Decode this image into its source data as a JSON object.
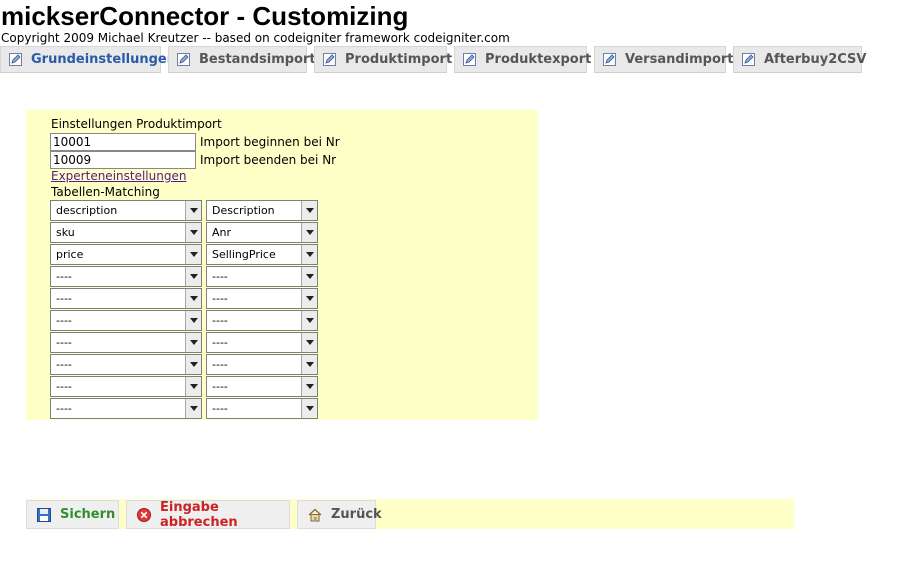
{
  "header": {
    "title": "mickserConnector - Customizing",
    "copyright": "Copyright 2009 Michael Kreutzer -- based on codeigniter framework codeigniter.com"
  },
  "tabs": [
    {
      "label": "Grundeinstellungen",
      "active": true
    },
    {
      "label": "Bestandsimport"
    },
    {
      "label": "Produktimport"
    },
    {
      "label": "Produktexport"
    },
    {
      "label": "Versandimport"
    },
    {
      "label": "Afterbuy2CSV"
    }
  ],
  "form": {
    "section_title": "Einstellungen Produktimport",
    "start_value": "10001",
    "start_label": "Import beginnen bei Nr",
    "end_value": "10009",
    "end_label": "Import beenden bei Nr",
    "expert_link": "Experteneinstellungen",
    "matching_title": "Tabellen-Matching",
    "matching": [
      {
        "left": "description",
        "right": "Description"
      },
      {
        "left": "sku",
        "right": "Anr"
      },
      {
        "left": "price",
        "right": "SellingPrice"
      },
      {
        "left": "----",
        "right": "----"
      },
      {
        "left": "----",
        "right": "----"
      },
      {
        "left": "----",
        "right": "----"
      },
      {
        "left": "----",
        "right": "----"
      },
      {
        "left": "----",
        "right": "----"
      },
      {
        "left": "----",
        "right": "----"
      },
      {
        "left": "----",
        "right": "----"
      }
    ]
  },
  "actions": {
    "save_label": "Sichern",
    "cancel_label": "Eingabe abbrechen",
    "back_label": "Zurück"
  },
  "colors": {
    "panel_bg": "#ffffc8",
    "save_text": "#2f8f2f",
    "cancel_text": "#cc2222",
    "back_text": "#555555",
    "active_tab": "#2a5aa8"
  }
}
